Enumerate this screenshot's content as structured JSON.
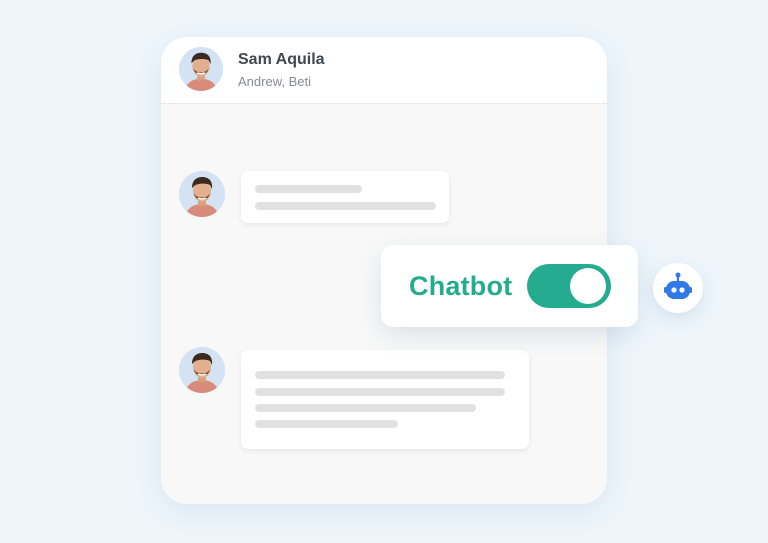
{
  "conversation": {
    "contact_name": "Sam Aquila",
    "participants": "Andrew, Beti"
  },
  "messages": [
    {
      "sender_avatar": "avatar-photo",
      "content": "placeholder-text-lines"
    },
    {
      "sender_avatar": "avatar-photo",
      "content": "placeholder-text-lines"
    }
  ],
  "chatbot": {
    "label": "Chatbot",
    "enabled": true,
    "icon": "robot-icon"
  },
  "colors": {
    "accent": "#25ab8f",
    "bot_icon": "#2f7ae5",
    "background": "#eef6fc"
  }
}
